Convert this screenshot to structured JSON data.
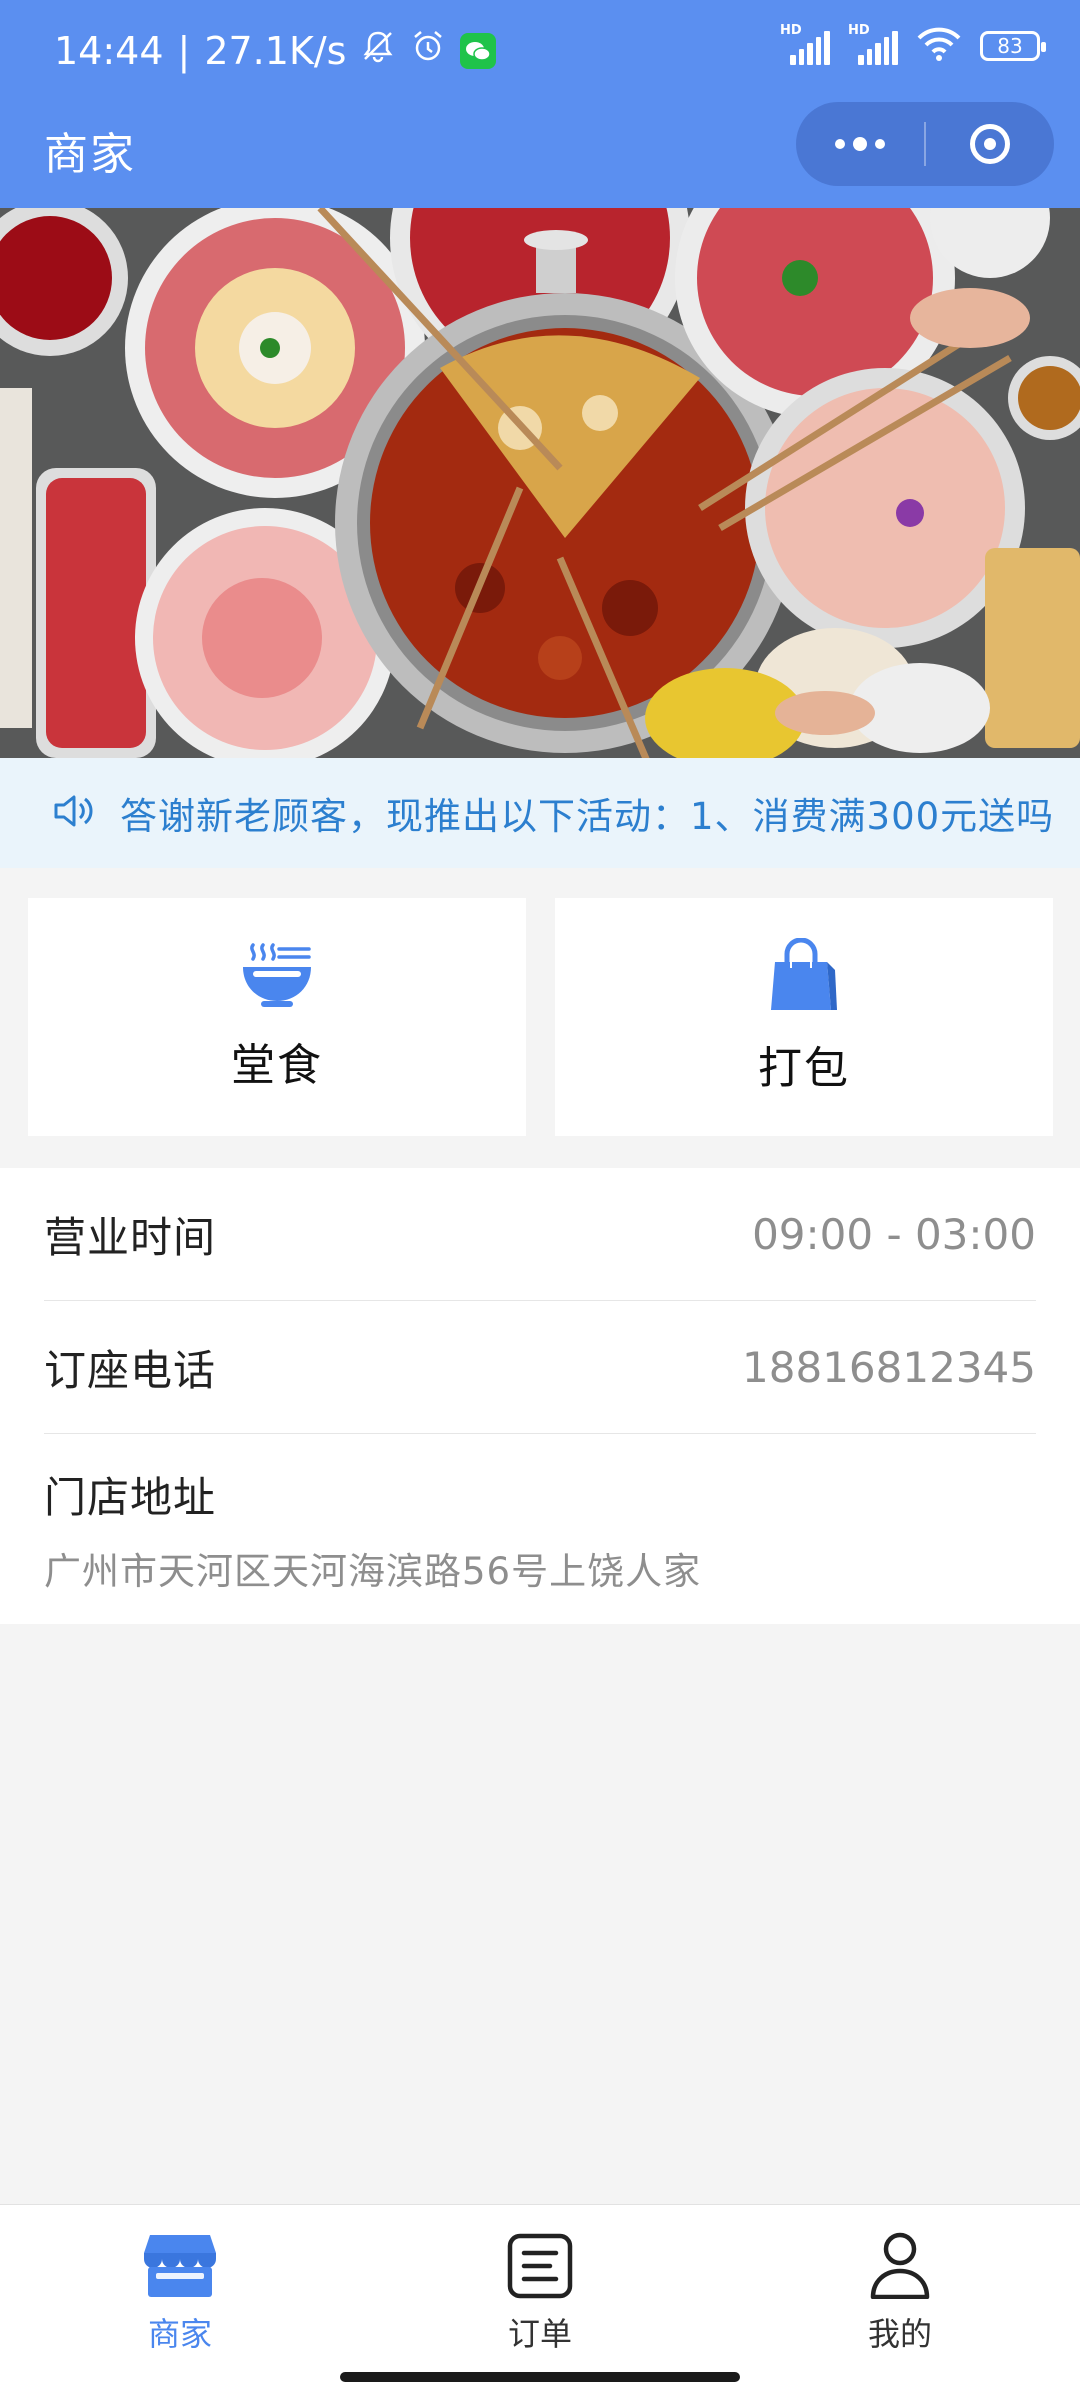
{
  "status_bar": {
    "time": "14:44",
    "net_speed": "27.1K/s",
    "battery": "83",
    "icons": [
      "mute-bell-icon",
      "alarm-icon",
      "wechat-icon",
      "hd-signal-icon",
      "hd-signal-icon",
      "wifi-icon",
      "battery-icon"
    ]
  },
  "nav": {
    "title": "商家",
    "more_icon": "more-dots-icon",
    "close_icon": "target-close-icon"
  },
  "notice": {
    "icon": "speaker-icon",
    "text": "答谢新老顾客，现推出以下活动：1、消费满300元送吗"
  },
  "services": [
    {
      "label": "堂食",
      "icon": "bowl-icon"
    },
    {
      "label": "打包",
      "icon": "shopping-bag-icon"
    }
  ],
  "info": {
    "hours_label": "营业时间",
    "hours_value": "09:00 - 03:00",
    "phone_label": "订座电话",
    "phone_value": "18816812345",
    "address_label": "门店地址",
    "address_value": "广州市天河区天河海滨路56号上饶人家"
  },
  "tabbar": [
    {
      "label": "商家",
      "icon": "store-icon",
      "active": true
    },
    {
      "label": "订单",
      "icon": "order-list-icon",
      "active": false
    },
    {
      "label": "我的",
      "icon": "user-icon",
      "active": false
    }
  ],
  "colors": {
    "header": "#5b8ff0",
    "notice_bg": "#eaf4fb",
    "notice_text": "#2c7fcf",
    "accent": "#4a86ee"
  }
}
